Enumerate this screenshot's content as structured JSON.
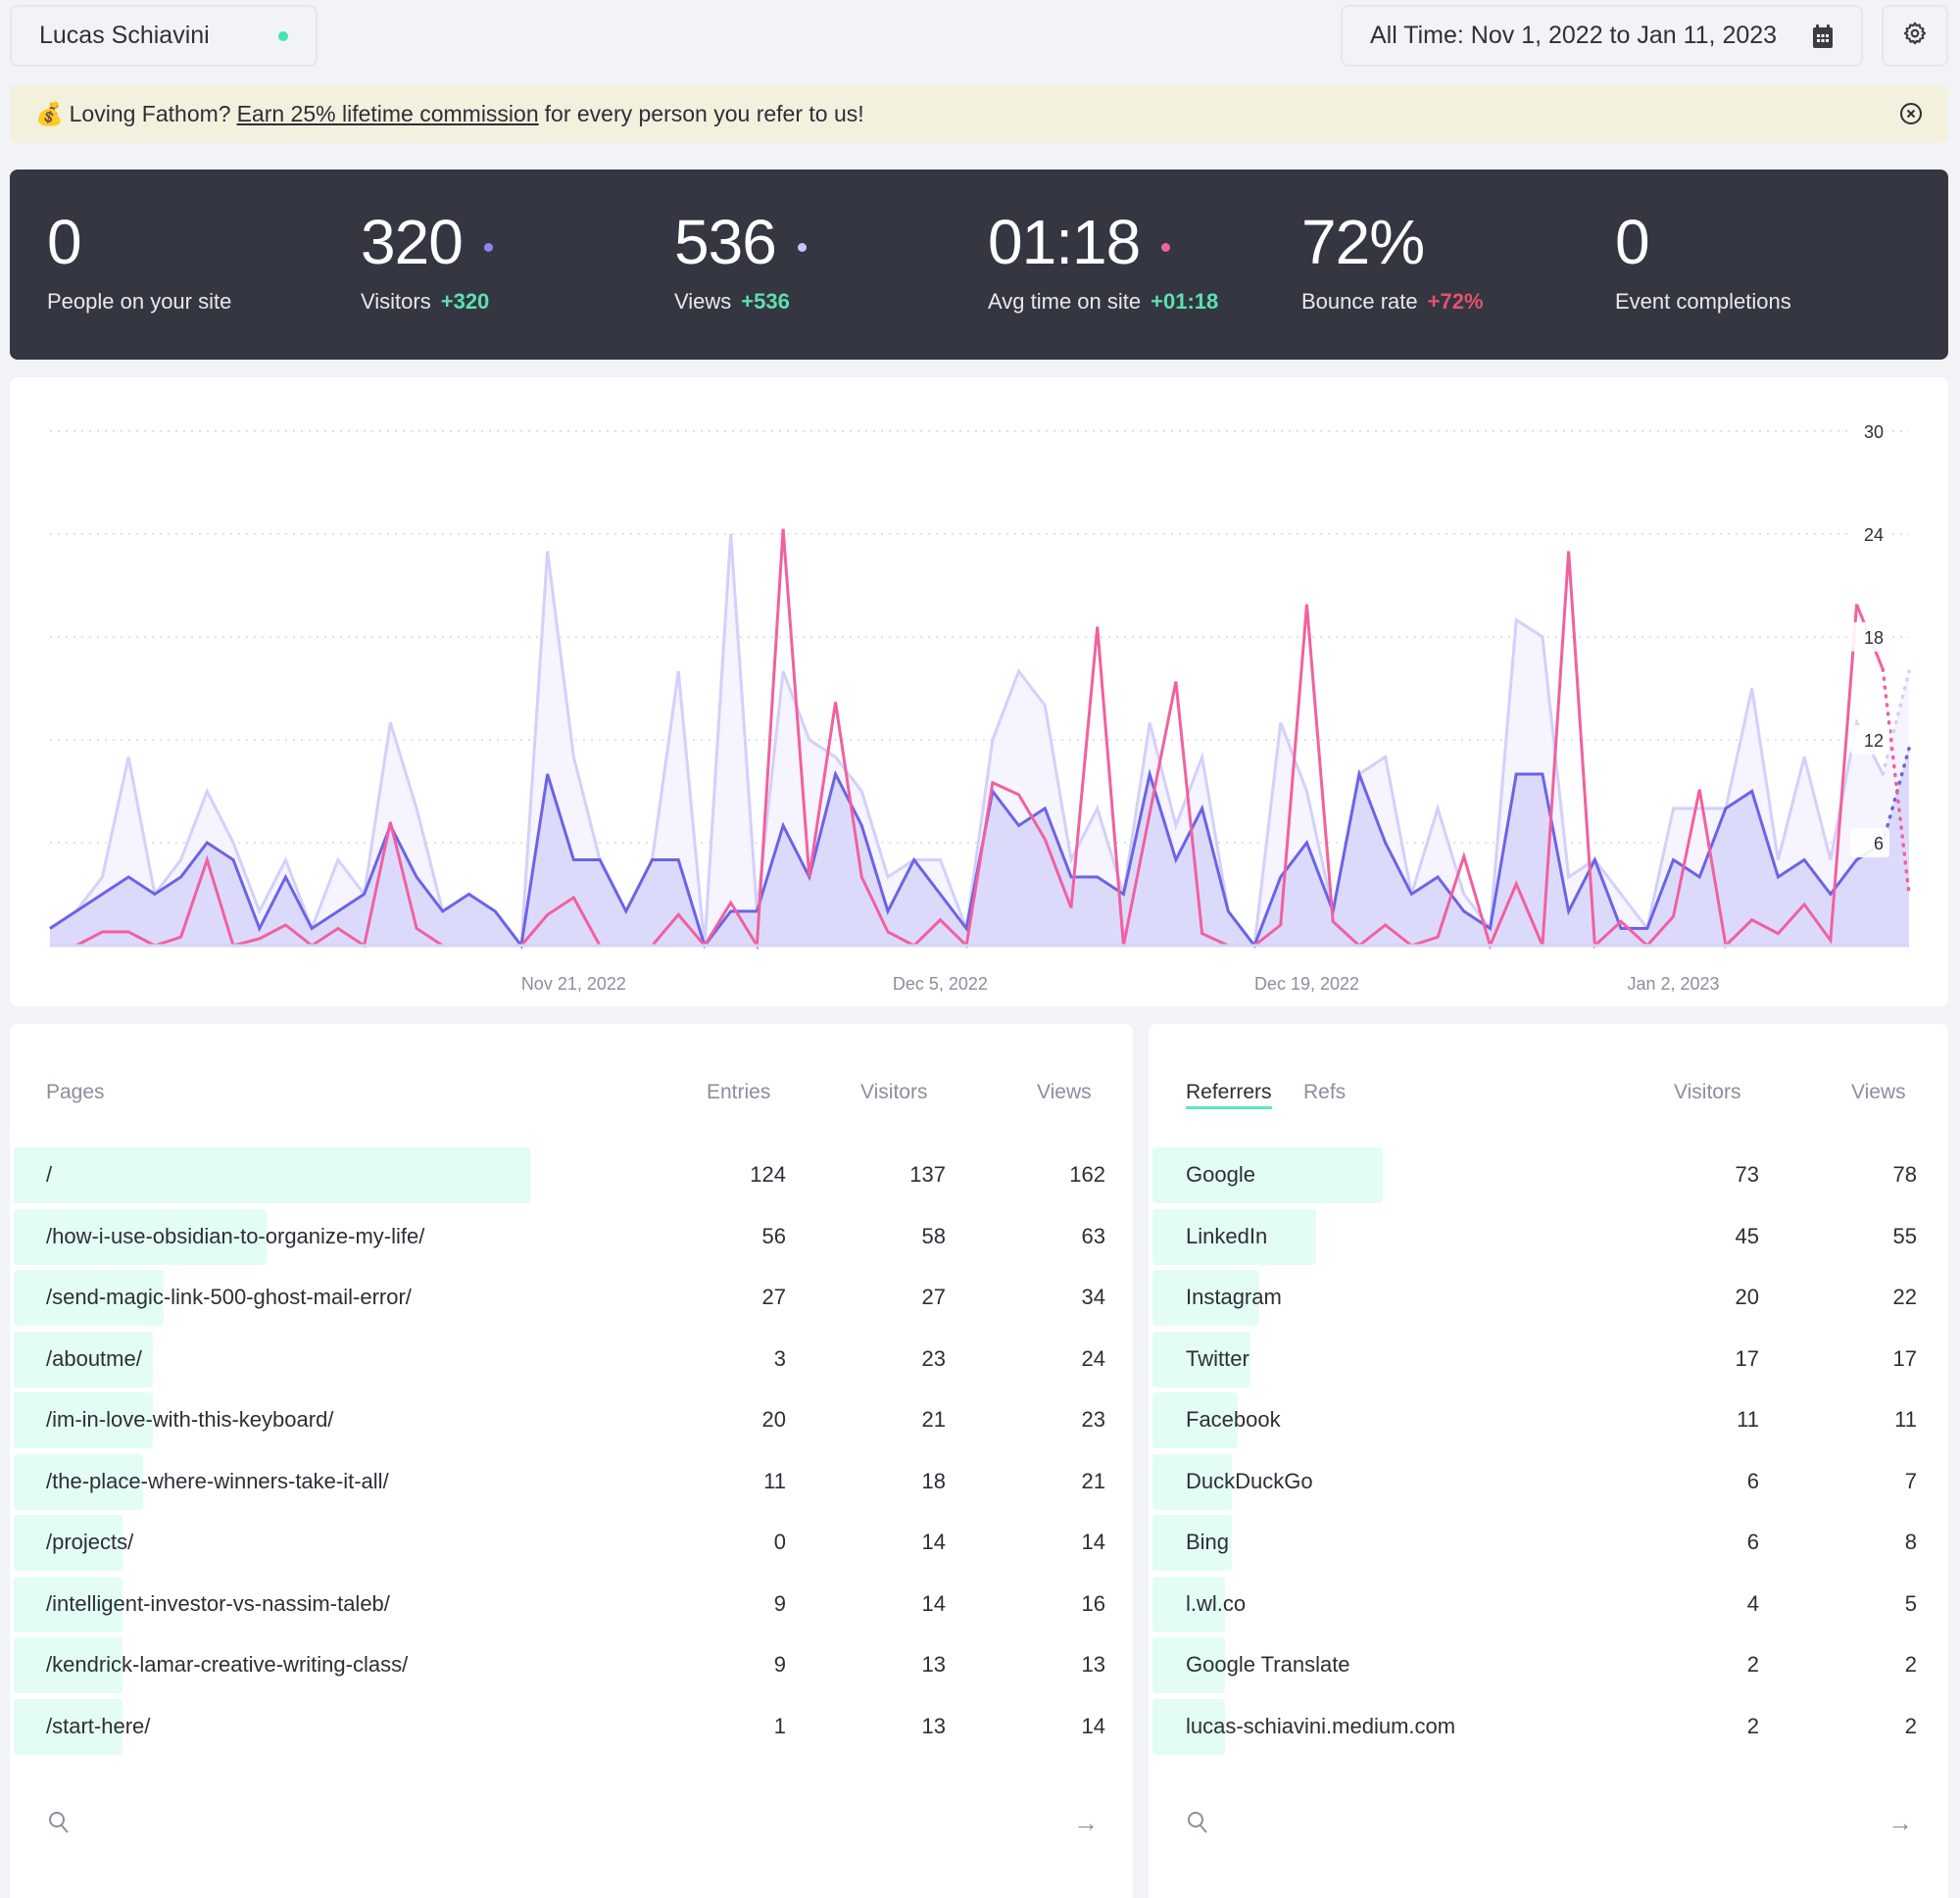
{
  "header": {
    "site_name": "Lucas Schiavini",
    "site_status_color": "#3ee6b0",
    "date_range": "All Time: Nov 1, 2022 to Jan 11, 2023",
    "calendar_icon": "calendar-icon",
    "settings_icon": "gear-icon"
  },
  "banner": {
    "emoji": "💰",
    "text_before": "Loving Fathom?",
    "link_text": "Earn 25% lifetime commission",
    "text_after": "for every person you refer to us!",
    "close_icon": "close-circle-icon"
  },
  "stats": [
    {
      "value": "0",
      "label": "People on your site",
      "change": "",
      "dot_color": ""
    },
    {
      "value": "320",
      "label": "Visitors",
      "change": "+320",
      "change_color": "#5de0b0",
      "dot_color": "#8b83f5"
    },
    {
      "value": "536",
      "label": "Views",
      "change": "+536",
      "change_color": "#5de0b0",
      "dot_color": "#c9c5fb"
    },
    {
      "value": "01:18",
      "label": "Avg time on site",
      "change": "+01:18",
      "change_color": "#5de0b0",
      "dot_color": "#f2609f"
    },
    {
      "value": "72%",
      "label": "Bounce rate",
      "change": "+72%",
      "change_color": "#e8506d",
      "dot_color": ""
    },
    {
      "value": "0",
      "label": "Event completions",
      "change": "",
      "dot_color": ""
    }
  ],
  "chart_data": {
    "type": "area",
    "title": "",
    "xlabel": "",
    "ylabel": "",
    "ylim": [
      0,
      30
    ],
    "yticks": [
      6,
      12,
      18,
      24,
      30
    ],
    "grid": true,
    "x_start": "Nov 1, 2022",
    "x_end": "Jan 11, 2023",
    "x_ticks": [
      {
        "index": 20,
        "label": "Nov 21, 2022"
      },
      {
        "index": 34,
        "label": "Dec 5, 2022"
      },
      {
        "index": 48,
        "label": "Dec 19, 2022"
      },
      {
        "index": 62,
        "label": "Jan 2, 2023"
      }
    ],
    "projected_from_index": 70,
    "series": [
      {
        "name": "Views",
        "color": "#d3d0fb",
        "fill": "#f5f4ff",
        "values": [
          1,
          2,
          4,
          11,
          3,
          5,
          9,
          6,
          2,
          5,
          1,
          5,
          3,
          13,
          8,
          2,
          3,
          2,
          0,
          23,
          11,
          5,
          2,
          5,
          16,
          0,
          24,
          2,
          16,
          12,
          11,
          9,
          4,
          5,
          5,
          1,
          12,
          16,
          14,
          5,
          8,
          3,
          13,
          7,
          11,
          2,
          0,
          13,
          9,
          2,
          10,
          11,
          3,
          8,
          3,
          1,
          19,
          18,
          4,
          5,
          3,
          1,
          8,
          8,
          8,
          15,
          5,
          11,
          5,
          13,
          10,
          16
        ]
      },
      {
        "name": "Visitors",
        "color": "#6c63e6",
        "fill": "#dcdafb",
        "values": [
          1,
          2,
          3,
          4,
          3,
          4,
          6,
          5,
          1,
          4,
          1,
          2,
          3,
          7,
          4,
          2,
          3,
          2,
          0,
          10,
          5,
          5,
          2,
          5,
          5,
          0,
          2,
          2,
          7,
          4,
          10,
          7,
          2,
          5,
          3,
          1,
          9,
          7,
          8,
          4,
          4,
          3,
          10,
          5,
          8,
          2,
          0,
          4,
          6,
          2,
          10,
          6,
          3,
          4,
          2,
          1,
          10,
          10,
          2,
          5,
          1,
          1,
          5,
          4,
          8,
          9,
          4,
          5,
          3,
          5,
          6,
          11.5
        ]
      },
      {
        "name": "Avg time on site",
        "color": "#f2609f",
        "fill": "none",
        "values": [
          0,
          0,
          0.8,
          0.8,
          0,
          0.5,
          5,
          0,
          0.4,
          1.2,
          0,
          1,
          0,
          7.2,
          1,
          0,
          0,
          0,
          0,
          1.8,
          2.8,
          0,
          0,
          0,
          1.8,
          0,
          2.5,
          0,
          24.3,
          4,
          14.2,
          4,
          0.8,
          0,
          1.5,
          0,
          9.5,
          8.8,
          6.2,
          2.2,
          18.6,
          0,
          7.7,
          15.4,
          0.7,
          0,
          0,
          1.2,
          19.9,
          1.4,
          0,
          1.2,
          0,
          0.5,
          5.2,
          0,
          3.6,
          0,
          23,
          0,
          1.4,
          0,
          1.7,
          9.1,
          0,
          1.5,
          0.7,
          2.4,
          0.3,
          19.9,
          16.1,
          3
        ]
      }
    ]
  },
  "pages": {
    "columns": [
      "Pages",
      "Entries",
      "Visitors",
      "Views"
    ],
    "max_views": 162,
    "rows": [
      {
        "name": "/",
        "entries": "124",
        "visitors": "137",
        "views": "162",
        "share": 1.0
      },
      {
        "name": "/how-i-use-obsidian-to-organize-my-life/",
        "entries": "56",
        "visitors": "58",
        "views": "63",
        "share": 0.49
      },
      {
        "name": "/send-magic-link-500-ghost-mail-error/",
        "entries": "27",
        "visitors": "27",
        "views": "34",
        "share": 0.29
      },
      {
        "name": "/aboutme/",
        "entries": "3",
        "visitors": "23",
        "views": "24",
        "share": 0.27
      },
      {
        "name": "/im-in-love-with-this-keyboard/",
        "entries": "20",
        "visitors": "21",
        "views": "23",
        "share": 0.27
      },
      {
        "name": "/the-place-where-winners-take-it-all/",
        "entries": "11",
        "visitors": "18",
        "views": "21",
        "share": 0.25
      },
      {
        "name": "/projects/",
        "entries": "0",
        "visitors": "14",
        "views": "14",
        "share": 0.21
      },
      {
        "name": "/intelligent-investor-vs-nassim-taleb/",
        "entries": "9",
        "visitors": "14",
        "views": "16",
        "share": 0.21
      },
      {
        "name": "/kendrick-lamar-creative-writing-class/",
        "entries": "9",
        "visitors": "13",
        "views": "13",
        "share": 0.21
      },
      {
        "name": "/start-here/",
        "entries": "1",
        "visitors": "13",
        "views": "14",
        "share": 0.21
      }
    ],
    "search_icon": "search-icon",
    "more_icon": "arrow-right-icon"
  },
  "referrers": {
    "tabs": [
      "Referrers",
      "Refs"
    ],
    "active_tab": 0,
    "columns": [
      "Visitors",
      "Views"
    ],
    "rows": [
      {
        "name": "Google",
        "visitors": "73",
        "views": "78",
        "share": 0.73
      },
      {
        "name": "LinkedIn",
        "visitors": "45",
        "views": "55",
        "share": 0.52
      },
      {
        "name": "Instagram",
        "visitors": "20",
        "views": "22",
        "share": 0.34
      },
      {
        "name": "Twitter",
        "visitors": "17",
        "views": "17",
        "share": 0.31
      },
      {
        "name": "Facebook",
        "visitors": "11",
        "views": "11",
        "share": 0.27
      },
      {
        "name": "DuckDuckGo",
        "visitors": "6",
        "views": "7",
        "share": 0.25
      },
      {
        "name": "Bing",
        "visitors": "6",
        "views": "8",
        "share": 0.25
      },
      {
        "name": "l.wl.co",
        "visitors": "4",
        "views": "5",
        "share": 0.23
      },
      {
        "name": "Google Translate",
        "visitors": "2",
        "views": "2",
        "share": 0.23
      },
      {
        "name": "lucas-schiavini.medium.com",
        "visitors": "2",
        "views": "2",
        "share": 0.23
      }
    ],
    "search_icon": "search-icon",
    "more_icon": "arrow-right-icon"
  }
}
